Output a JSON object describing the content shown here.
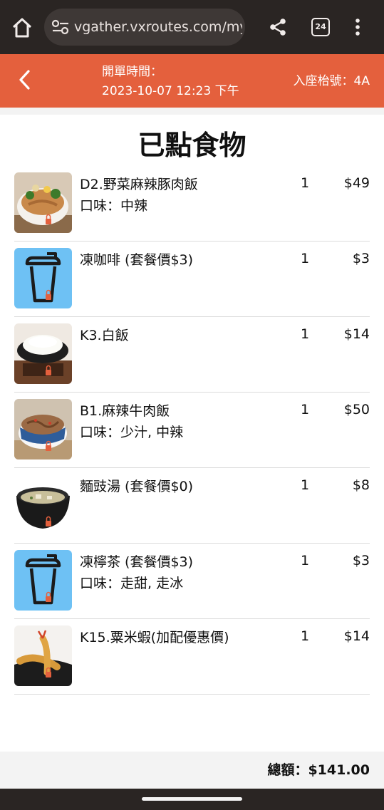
{
  "browser": {
    "url": "vgather.vxroutes.com/my",
    "tab_count": "24",
    "icons": [
      "home-icon",
      "tune-icon",
      "share-icon",
      "tabs-icon",
      "more-vert-icon"
    ]
  },
  "header": {
    "open_time_label": "開單時間：",
    "open_time_value": "2023-10-07 12:23 下午",
    "table_label": "入座枱號：4A",
    "accent_color": "#e4603d"
  },
  "page": {
    "title": "已點食物"
  },
  "orders": [
    {
      "name": "D2.野菜麻辣豚肉飯",
      "option": "口味：中辣",
      "qty": "1",
      "price": "$49",
      "image": "pork-rice-photo"
    },
    {
      "name": "凍咖啡 (套餐價$3)",
      "option": "",
      "qty": "1",
      "price": "$3",
      "image": "drink-cup-icon"
    },
    {
      "name": "K3.白飯",
      "option": "",
      "qty": "1",
      "price": "$14",
      "image": "white-rice-photo"
    },
    {
      "name": "B1.麻辣牛肉飯",
      "option": "口味：少汁, 中辣",
      "qty": "1",
      "price": "$50",
      "image": "beef-rice-photo"
    },
    {
      "name": "麵豉湯 (套餐價$0)",
      "option": "",
      "qty": "1",
      "price": "$8",
      "image": "miso-soup-photo"
    },
    {
      "name": "凍檸茶 (套餐價$3)",
      "option": "口味：走甜, 走冰",
      "qty": "1",
      "price": "$3",
      "image": "drink-cup-icon"
    },
    {
      "name": "K15.粟米蝦(加配優惠價)",
      "option": "",
      "qty": "1",
      "price": "$14",
      "image": "fried-shrimp-photo"
    }
  ],
  "footer": {
    "total_label": "總額：",
    "total_value": "$141.00"
  }
}
